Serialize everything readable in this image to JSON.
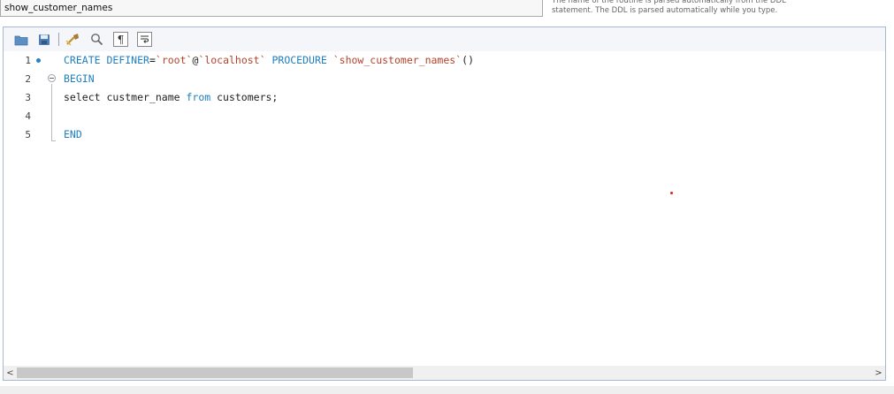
{
  "routine": {
    "name_value": "show_customer_names",
    "hint": "The name of the routine is parsed automatically from the DDL statement. The DDL is parsed automatically while you type."
  },
  "toolbar": {
    "icons": [
      "open-folder-icon",
      "save-icon",
      "beautify-icon",
      "find-icon",
      "toggle-invisibles-icon",
      "word-wrap-icon"
    ]
  },
  "editor": {
    "lines": [
      {
        "number": "1",
        "tokens": [
          {
            "text": "CREATE",
            "cls": "kw"
          },
          {
            "text": " ",
            "cls": "id"
          },
          {
            "text": "DEFINER",
            "cls": "kw"
          },
          {
            "text": "=",
            "cls": "id"
          },
          {
            "text": "`root`",
            "cls": "str"
          },
          {
            "text": "@",
            "cls": "id"
          },
          {
            "text": "`localhost`",
            "cls": "str"
          },
          {
            "text": " ",
            "cls": "id"
          },
          {
            "text": "PROCEDURE",
            "cls": "kw"
          },
          {
            "text": " ",
            "cls": "id"
          },
          {
            "text": "`show_customer_names`",
            "cls": "str"
          },
          {
            "text": "()",
            "cls": "id"
          }
        ]
      },
      {
        "number": "2",
        "tokens": [
          {
            "text": "BEGIN",
            "cls": "kw"
          }
        ]
      },
      {
        "number": "3",
        "tokens": [
          {
            "text": "select",
            "cls": "id"
          },
          {
            "text": " custmer_name ",
            "cls": "id"
          },
          {
            "text": "from",
            "cls": "kw"
          },
          {
            "text": " customers;",
            "cls": "id"
          }
        ]
      },
      {
        "number": "4",
        "tokens": []
      },
      {
        "number": "5",
        "tokens": [
          {
            "text": "END",
            "cls": "kw"
          }
        ]
      }
    ]
  },
  "scrollbar": {
    "left_arrow": "<",
    "right_arrow": ">"
  }
}
